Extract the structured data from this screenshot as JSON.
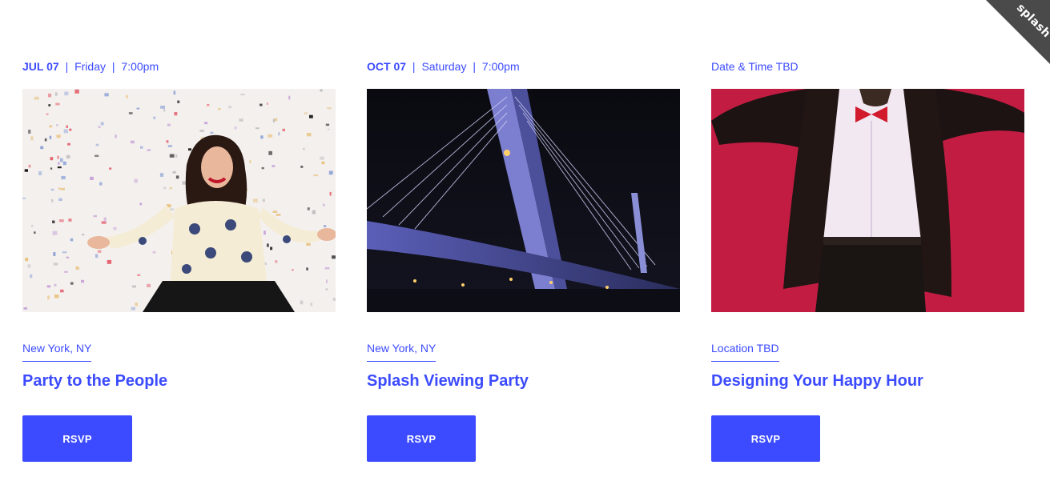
{
  "brand": {
    "ribbon_text": "splash"
  },
  "events": [
    {
      "date": "JUL 07",
      "day": "Friday",
      "time": "7:00pm",
      "datetime_text": "",
      "image": "party-confetti-photo",
      "location": "New York, NY",
      "title": "Party to the People",
      "rsvp_label": "RSVP"
    },
    {
      "date": "OCT 07",
      "day": "Saturday",
      "time": "7:00pm",
      "datetime_text": "",
      "image": "night-bridge-photo",
      "location": "New York, NY",
      "title": "Splash Viewing Party",
      "rsvp_label": "RSVP"
    },
    {
      "date": "",
      "day": "",
      "time": "",
      "datetime_text": "Date & Time TBD",
      "image": "dancing-man-photo",
      "location": "Location TBD",
      "title": "Designing Your Happy Hour",
      "rsvp_label": "RSVP"
    }
  ],
  "separator": "|",
  "colors": {
    "accent": "#3c4bff",
    "ribbon": "#4a4a4a"
  }
}
